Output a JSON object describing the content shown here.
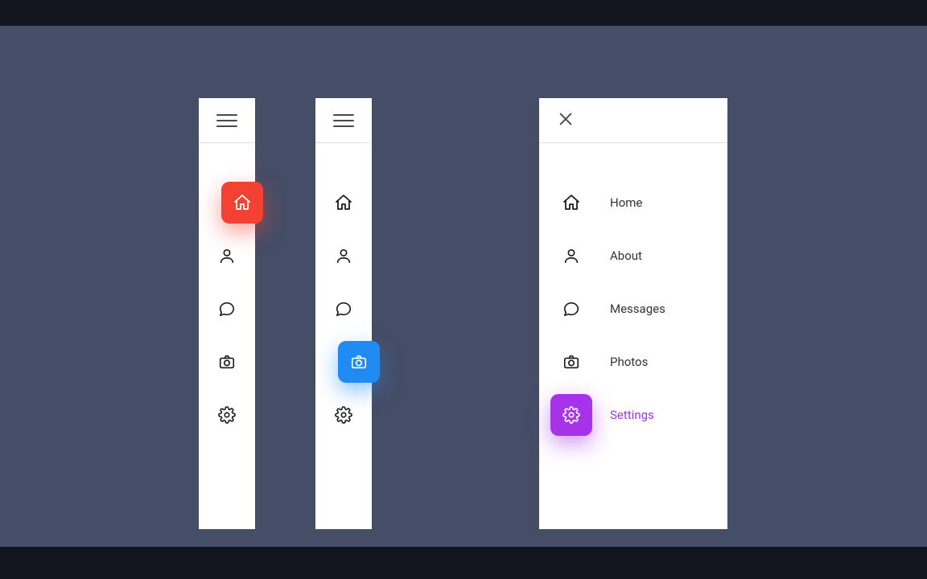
{
  "menus": {
    "items": [
      {
        "key": "home",
        "label": "Home"
      },
      {
        "key": "about",
        "label": "About"
      },
      {
        "key": "messages",
        "label": "Messages"
      },
      {
        "key": "photos",
        "label": "Photos"
      },
      {
        "key": "settings",
        "label": "Settings"
      }
    ],
    "panel1": {
      "expanded": false,
      "active": "home"
    },
    "panel2": {
      "expanded": false,
      "active": "photos"
    },
    "panel3": {
      "expanded": true,
      "active": "settings"
    }
  },
  "colors": {
    "canvas": "#464d66",
    "home": "#f34233",
    "photos": "#1f8bf3",
    "settings": "#a632ea"
  },
  "icons": {
    "hamburger": "hamburger-icon",
    "close": "close-icon",
    "home": "house-icon",
    "about": "user-icon",
    "messages": "chat-icon",
    "photos": "camera-icon",
    "settings": "gear-icon"
  }
}
